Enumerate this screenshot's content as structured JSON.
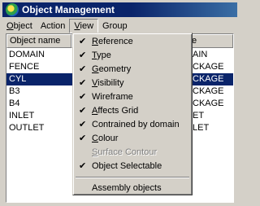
{
  "window": {
    "title": "Object Management"
  },
  "menubar": {
    "items": [
      {
        "label": "Object",
        "underline": "O",
        "rest": "bject"
      },
      {
        "label": "Action",
        "underline": "",
        "rest": "Action"
      },
      {
        "label": "View",
        "underline": "V",
        "rest": "iew"
      },
      {
        "label": "Group",
        "underline": "",
        "rest": "Group"
      }
    ]
  },
  "list": {
    "columns": [
      "Object name",
      "e"
    ],
    "rows": [
      {
        "name": "DOMAIN",
        "type": "AIN"
      },
      {
        "name": "FENCE",
        "type": "CKAGE"
      },
      {
        "name": "CYL",
        "type": "CKAGE",
        "selected": true
      },
      {
        "name": "B3",
        "type": "CKAGE"
      },
      {
        "name": "B4",
        "type": "CKAGE"
      },
      {
        "name": "INLET",
        "type": "ET"
      },
      {
        "name": "OUTLET",
        "type": "LET"
      }
    ]
  },
  "view_menu": {
    "items": [
      {
        "label": "Reference",
        "u": "R",
        "rest": "eference",
        "checked": true
      },
      {
        "label": "Type",
        "u": "T",
        "rest": "ype",
        "checked": true
      },
      {
        "label": "Geometry",
        "u": "G",
        "rest": "eometry",
        "checked": true
      },
      {
        "label": "Visibility",
        "u": "V",
        "rest": "isibility",
        "checked": true
      },
      {
        "label": "Wireframe",
        "u": "",
        "rest": "Wireframe",
        "checked": true
      },
      {
        "label": "Affects Grid",
        "u": "A",
        "rest": "ffects Grid",
        "checked": true
      },
      {
        "label": "Contrained by domain",
        "u": "",
        "rest": "Contrained by domain",
        "checked": true
      },
      {
        "label": "Colour",
        "u": "C",
        "rest": "olour",
        "checked": true
      },
      {
        "label": "Surface Contour",
        "u": "S",
        "rest": "urface Contour",
        "checked": false,
        "disabled": true
      },
      {
        "label": "Object Selectable",
        "u": "",
        "rest": "Object Selectable",
        "checked": true
      }
    ],
    "footer_item": "Assembly objects",
    "check_glyph": "✔"
  }
}
